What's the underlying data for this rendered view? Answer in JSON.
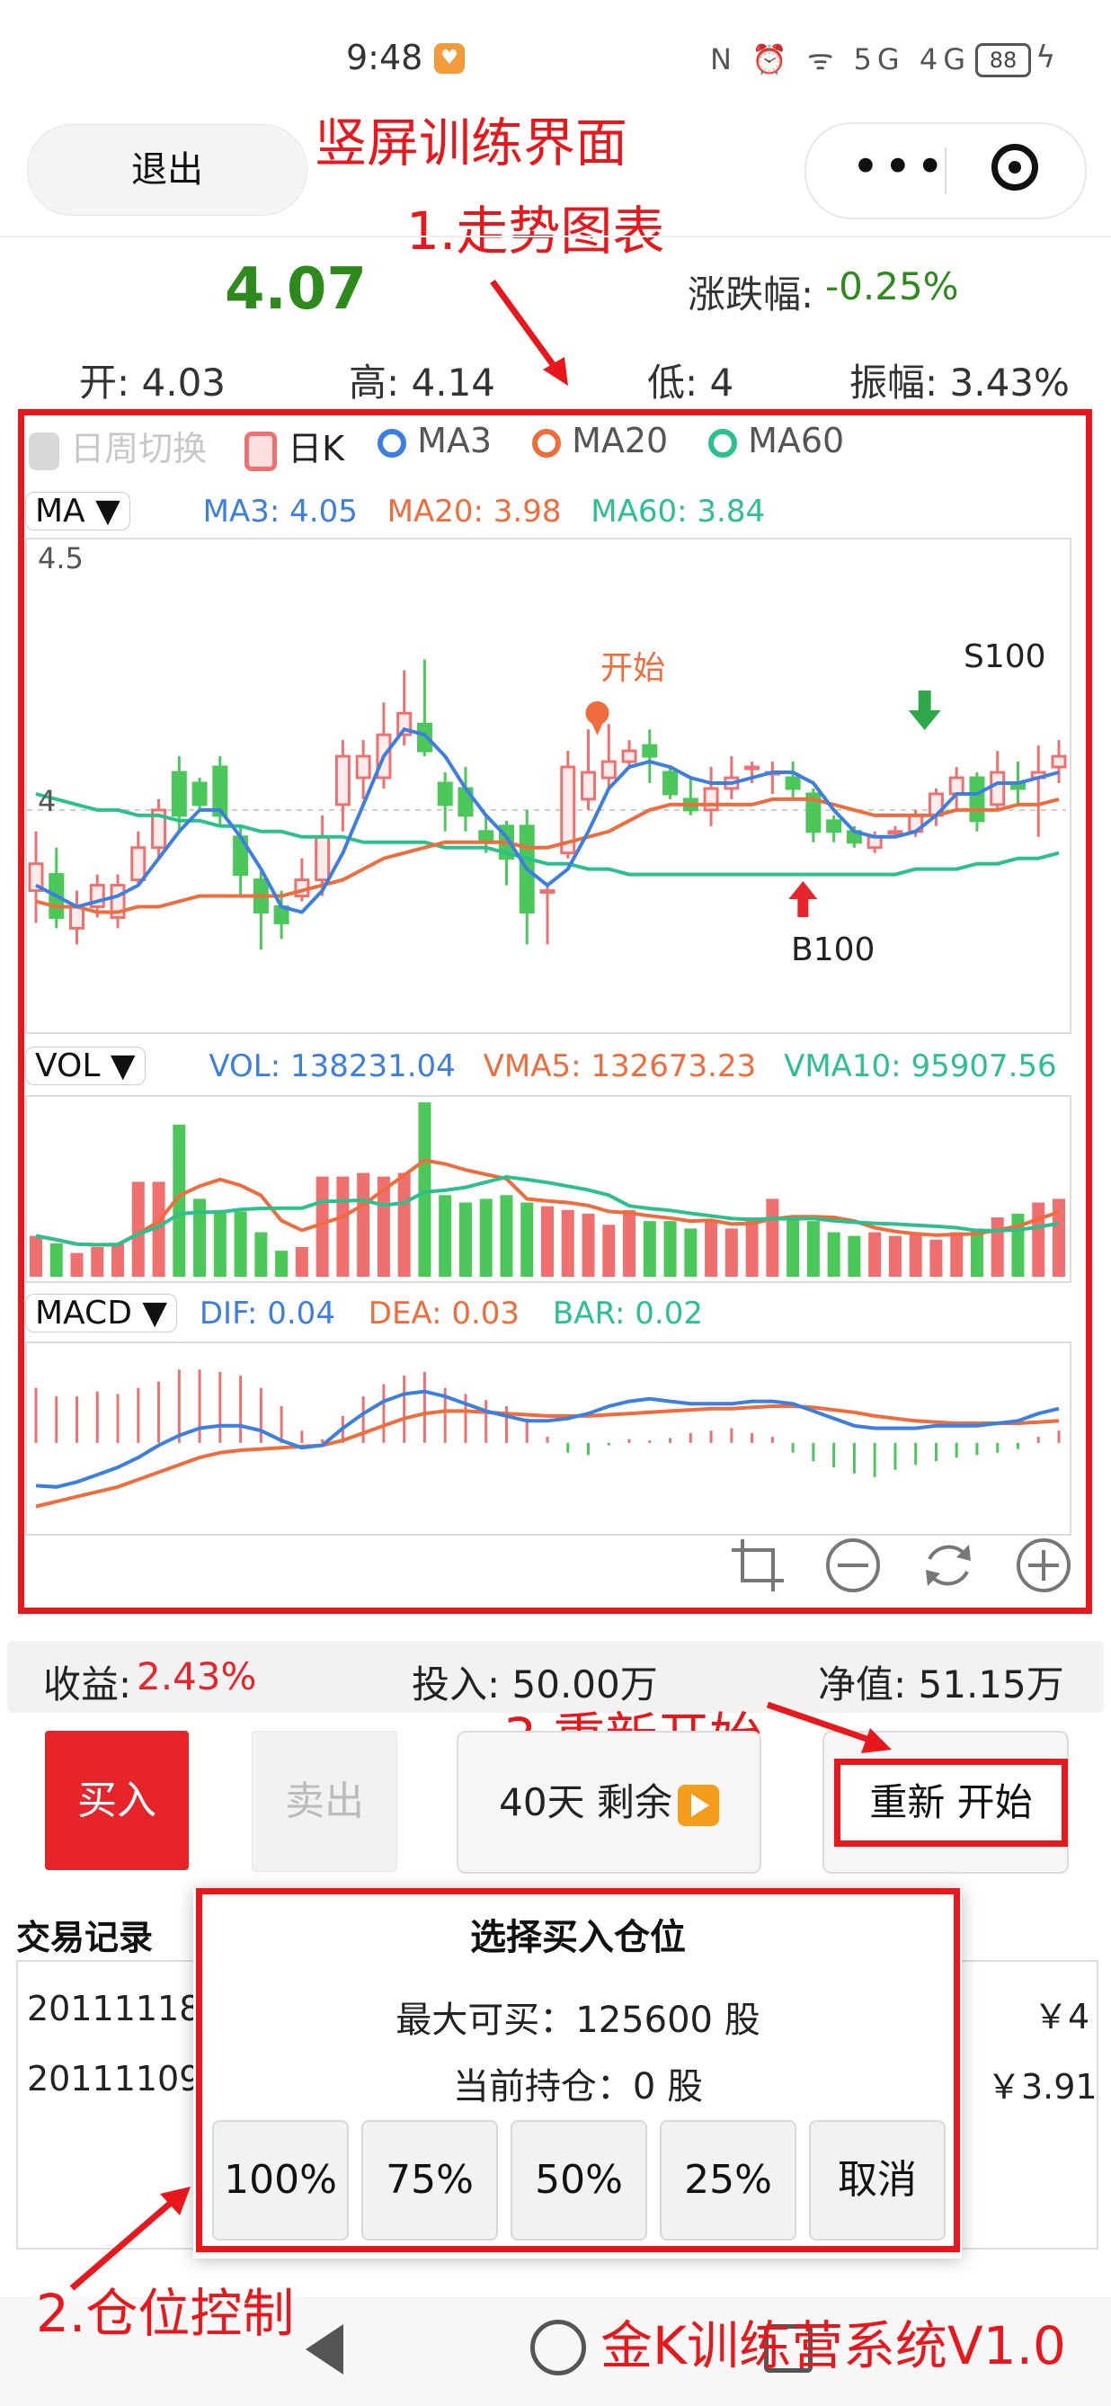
{
  "status_bar": {
    "time": "9:48",
    "network": "N ⏰ ᯤ 5G 4G",
    "battery": "88"
  },
  "header": {
    "exit_label": "退出",
    "menu_icon": "more-dots-icon",
    "target_icon": "record-target-icon"
  },
  "annotations": {
    "title": "竖屏训练界面",
    "chart": "1.走势图表",
    "position": "2.仓位控制",
    "restart": "3.重新开始",
    "system": "金K训练营系统V1.0"
  },
  "quote": {
    "price": "4.07",
    "change_label": "涨跌幅:",
    "change_value": "-0.25%",
    "open": "开: 4.03",
    "high": "高: 4.14",
    "low": "低: 4",
    "amplitude": "振幅: 3.43%"
  },
  "legend": [
    {
      "label": "日周切换",
      "color": "#d0d0d0"
    },
    {
      "label": "日K",
      "color": "#f07070"
    },
    {
      "label": "MA3",
      "color": "#3d7fe0"
    },
    {
      "label": "MA20",
      "color": "#ef6c3c"
    },
    {
      "label": "MA60",
      "color": "#2cc08e"
    }
  ],
  "ma_panel": {
    "selector": "MA ▼",
    "ma3": "MA3: 4.05",
    "ma20": "MA20: 3.98",
    "ma60": "MA60: 3.84",
    "y_top": "4.5",
    "y_mid": "4",
    "marker_start": "开始",
    "marker_sell": "S100",
    "marker_buy": "B100"
  },
  "vol_panel": {
    "selector": "VOL ▼",
    "vol": "VOL: 138231.04",
    "vma5": "VMA5: 132673.23",
    "vma10": "VMA10: 95907.56"
  },
  "macd_panel": {
    "selector": "MACD ▼",
    "dif": "DIF: 0.04",
    "dea": "DEA: 0.03",
    "bar": "BAR: 0.02"
  },
  "colors": {
    "up": "#f07070",
    "down": "#4cc75a",
    "ma3": "#3d7fe0",
    "ma20": "#ef6c3c",
    "ma60": "#2cc08e",
    "annot": "#e8171c"
  },
  "chart_data": {
    "type": "candlestick",
    "ylim": [
      3.6,
      4.5
    ],
    "candles": [
      [
        3.85,
        3.9,
        3.79,
        3.96
      ],
      [
        3.88,
        3.8,
        3.78,
        3.93
      ],
      [
        3.78,
        3.82,
        3.75,
        3.85
      ],
      [
        3.82,
        3.86,
        3.8,
        3.88
      ],
      [
        3.8,
        3.86,
        3.78,
        3.88
      ],
      [
        3.87,
        3.93,
        3.86,
        3.96
      ],
      [
        3.93,
        4.0,
        3.91,
        4.02
      ],
      [
        4.07,
        3.99,
        3.96,
        4.1
      ],
      [
        4.05,
        4.01,
        4.0,
        4.06
      ],
      [
        4.08,
        3.99,
        3.97,
        4.1
      ],
      [
        3.95,
        3.88,
        3.84,
        3.97
      ],
      [
        3.87,
        3.81,
        3.74,
        3.89
      ],
      [
        3.82,
        3.79,
        3.76,
        3.85
      ],
      [
        3.84,
        3.87,
        3.83,
        3.91
      ],
      [
        3.87,
        3.95,
        3.84,
        3.99
      ],
      [
        4.01,
        4.1,
        3.96,
        4.13
      ],
      [
        4.06,
        4.1,
        4.02,
        4.13
      ],
      [
        4.06,
        4.14,
        4.04,
        4.2
      ],
      [
        4.14,
        4.18,
        4.12,
        4.26
      ],
      [
        4.16,
        4.11,
        4.1,
        4.28
      ],
      [
        4.05,
        4.01,
        3.96,
        4.07
      ],
      [
        4.04,
        3.99,
        3.96,
        4.08
      ],
      [
        3.96,
        3.94,
        3.92,
        3.99
      ],
      [
        3.97,
        3.91,
        3.86,
        3.98
      ],
      [
        3.97,
        3.81,
        3.75,
        4.0
      ],
      [
        3.85,
        3.85,
        3.75,
        3.86
      ],
      [
        3.92,
        4.08,
        3.91,
        4.11
      ],
      [
        4.02,
        4.07,
        4.0,
        4.15
      ],
      [
        4.06,
        4.09,
        4.04,
        4.16
      ],
      [
        4.09,
        4.11,
        4.08,
        4.13
      ],
      [
        4.12,
        4.1,
        4.05,
        4.15
      ],
      [
        4.07,
        4.03,
        4.02,
        4.08
      ],
      [
        4.02,
        4.0,
        3.99,
        4.06
      ],
      [
        4.0,
        4.04,
        3.97,
        4.08
      ],
      [
        4.04,
        4.06,
        4.02,
        4.1
      ],
      [
        4.08,
        4.08,
        4.05,
        4.09
      ],
      [
        4.07,
        4.07,
        4.03,
        4.09
      ],
      [
        4.06,
        4.04,
        4.02,
        4.09
      ],
      [
        4.03,
        3.96,
        3.94,
        4.04
      ],
      [
        3.98,
        3.96,
        3.94,
        3.99
      ],
      [
        3.96,
        3.94,
        3.93,
        3.97
      ],
      [
        3.93,
        3.95,
        3.92,
        3.96
      ],
      [
        3.96,
        3.96,
        3.95,
        3.97
      ],
      [
        3.96,
        3.99,
        3.95,
        4.0
      ],
      [
        3.99,
        4.03,
        3.97,
        4.04
      ],
      [
        4.03,
        4.06,
        4.0,
        4.08
      ],
      [
        4.06,
        3.98,
        3.96,
        4.07
      ],
      [
        4.01,
        4.07,
        4.0,
        4.11
      ],
      [
        4.05,
        4.04,
        4.01,
        4.09
      ],
      [
        4.06,
        4.07,
        3.95,
        4.12
      ],
      [
        4.08,
        4.1,
        4.05,
        4.13
      ]
    ],
    "ma3": [
      3.86,
      3.84,
      3.82,
      3.83,
      3.84,
      3.86,
      3.91,
      3.96,
      4.0,
      4.0,
      3.95,
      3.89,
      3.82,
      3.81,
      3.85,
      3.92,
      4.01,
      4.1,
      4.15,
      4.14,
      4.1,
      4.04,
      3.99,
      3.95,
      3.89,
      3.86,
      3.89,
      3.96,
      4.04,
      4.08,
      4.09,
      4.08,
      4.06,
      4.05,
      4.05,
      4.06,
      4.07,
      4.07,
      4.05,
      4.0,
      3.96,
      3.95,
      3.95,
      3.96,
      3.99,
      4.03,
      4.03,
      4.05,
      4.05,
      4.06,
      4.07
    ],
    "ma20": [
      3.83,
      3.82,
      3.82,
      3.81,
      3.81,
      3.82,
      3.82,
      3.83,
      3.84,
      3.84,
      3.84,
      3.84,
      3.84,
      3.85,
      3.86,
      3.87,
      3.89,
      3.91,
      3.92,
      3.93,
      3.94,
      3.94,
      3.94,
      3.94,
      3.93,
      3.93,
      3.94,
      3.95,
      3.96,
      3.98,
      4.0,
      4.01,
      4.01,
      4.01,
      4.01,
      4.01,
      4.02,
      4.02,
      4.02,
      4.01,
      4.0,
      3.99,
      3.99,
      3.99,
      3.99,
      4.0,
      4.0,
      4.0,
      4.01,
      4.01,
      4.02
    ],
    "ma60": [
      4.03,
      4.02,
      4.01,
      4.0,
      4.0,
      3.99,
      3.99,
      3.98,
      3.98,
      3.97,
      3.97,
      3.96,
      3.96,
      3.95,
      3.95,
      3.95,
      3.94,
      3.94,
      3.94,
      3.94,
      3.93,
      3.93,
      3.93,
      3.92,
      3.91,
      3.9,
      3.9,
      3.89,
      3.89,
      3.88,
      3.88,
      3.88,
      3.88,
      3.88,
      3.88,
      3.88,
      3.88,
      3.88,
      3.88,
      3.88,
      3.88,
      3.88,
      3.88,
      3.89,
      3.89,
      3.89,
      3.9,
      3.9,
      3.91,
      3.91,
      3.92
    ],
    "volume": [
      55,
      45,
      32,
      40,
      45,
      128,
      128,
      205,
      105,
      90,
      88,
      60,
      35,
      40,
      135,
      135,
      140,
      135,
      140,
      235,
      110,
      100,
      105,
      110,
      100,
      95,
      90,
      85,
      70,
      90,
      75,
      75,
      65,
      75,
      65,
      80,
      105,
      80,
      75,
      60,
      55,
      60,
      55,
      60,
      50,
      60,
      65,
      80,
      85,
      100,
      105
    ],
    "macd_bar": [
      0.045,
      0.038,
      0.038,
      0.042,
      0.04,
      0.045,
      0.05,
      0.06,
      0.06,
      0.058,
      0.055,
      0.045,
      0.03,
      0.01,
      0.003,
      0.022,
      0.038,
      0.048,
      0.055,
      0.058,
      0.045,
      0.04,
      0.035,
      0.03,
      0.02,
      0.005,
      -0.008,
      -0.01,
      -0.002,
      0.003,
      0.002,
      0.004,
      0.008,
      0.01,
      0.012,
      0.008,
      0.005,
      -0.008,
      -0.015,
      -0.02,
      -0.025,
      -0.028,
      -0.022,
      -0.018,
      -0.015,
      -0.012,
      -0.01,
      -0.008,
      -0.005,
      0.005,
      0.01
    ],
    "dif": [
      -0.035,
      -0.036,
      -0.032,
      -0.026,
      -0.02,
      -0.012,
      -0.002,
      0.006,
      0.012,
      0.014,
      0.014,
      0.01,
      0.002,
      -0.004,
      -0.002,
      0.012,
      0.024,
      0.034,
      0.04,
      0.042,
      0.038,
      0.032,
      0.026,
      0.022,
      0.018,
      0.018,
      0.02,
      0.024,
      0.03,
      0.034,
      0.036,
      0.034,
      0.032,
      0.032,
      0.032,
      0.034,
      0.034,
      0.032,
      0.026,
      0.02,
      0.014,
      0.012,
      0.012,
      0.012,
      0.014,
      0.014,
      0.014,
      0.016,
      0.018,
      0.024,
      0.028
    ],
    "dea": [
      -0.052,
      -0.048,
      -0.044,
      -0.04,
      -0.036,
      -0.03,
      -0.024,
      -0.018,
      -0.012,
      -0.008,
      -0.006,
      -0.005,
      -0.004,
      -0.003,
      -0.002,
      0.002,
      0.008,
      0.014,
      0.02,
      0.024,
      0.026,
      0.026,
      0.025,
      0.024,
      0.023,
      0.022,
      0.022,
      0.022,
      0.023,
      0.024,
      0.025,
      0.026,
      0.027,
      0.028,
      0.028,
      0.029,
      0.03,
      0.03,
      0.029,
      0.027,
      0.025,
      0.022,
      0.02,
      0.018,
      0.017,
      0.016,
      0.016,
      0.016,
      0.016,
      0.017,
      0.018
    ]
  },
  "summary": {
    "profit_label": "收益:",
    "profit_value": "2.43%",
    "invest": "投入: 50.00万",
    "net": "净值: 51.15万"
  },
  "actions": {
    "buy": "买入",
    "sell": "卖出",
    "days": "40天 剩余",
    "restart": "重新 开始"
  },
  "records": {
    "title": "交易记录",
    "rows": [
      {
        "date": "20111118",
        "price": "￥4"
      },
      {
        "date": "20111109",
        "price": "￥3.91"
      }
    ]
  },
  "modal": {
    "title": "选择买入仓位",
    "max_buy": "最大可买：125600 股",
    "holding": "当前持仓：0 股",
    "options": [
      "100%",
      "75%",
      "50%",
      "25%",
      "取消"
    ]
  }
}
